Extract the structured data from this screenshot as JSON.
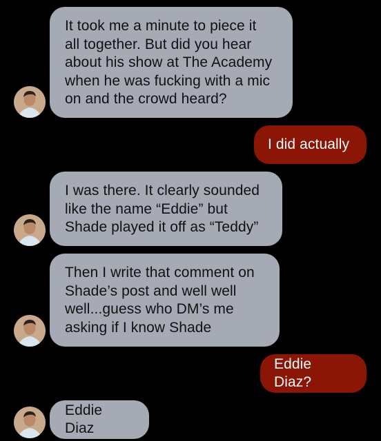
{
  "conversation": {
    "messages": [
      {
        "direction": "incoming",
        "text": "It took me a minute to piece it\nall together. But did you hear\nabout his show at The Academy\nwhen he was fucking with a mic\non and the crowd heard?"
      },
      {
        "direction": "outgoing",
        "text": "I did actually"
      },
      {
        "direction": "incoming",
        "text": "I was there. It clearly sounded\nlike the name “Eddie” but\nShade played it off as “Teddy”"
      },
      {
        "direction": "incoming",
        "text": "Then I write that comment on\nShade’s post and well well\nwell...guess who DM’s me\nasking if I know Shade"
      },
      {
        "direction": "outgoing",
        "text": "Eddie Diaz?"
      },
      {
        "direction": "incoming",
        "text": "Eddie Diaz"
      }
    ],
    "avatar_icon": "contact-photo-icon"
  },
  "theme": {
    "background": "#000000",
    "incoming_bubble": "#a6aab5",
    "outgoing_bubble": "#8b1606",
    "incoming_text": "#111111",
    "outgoing_text": "#ffffff"
  }
}
